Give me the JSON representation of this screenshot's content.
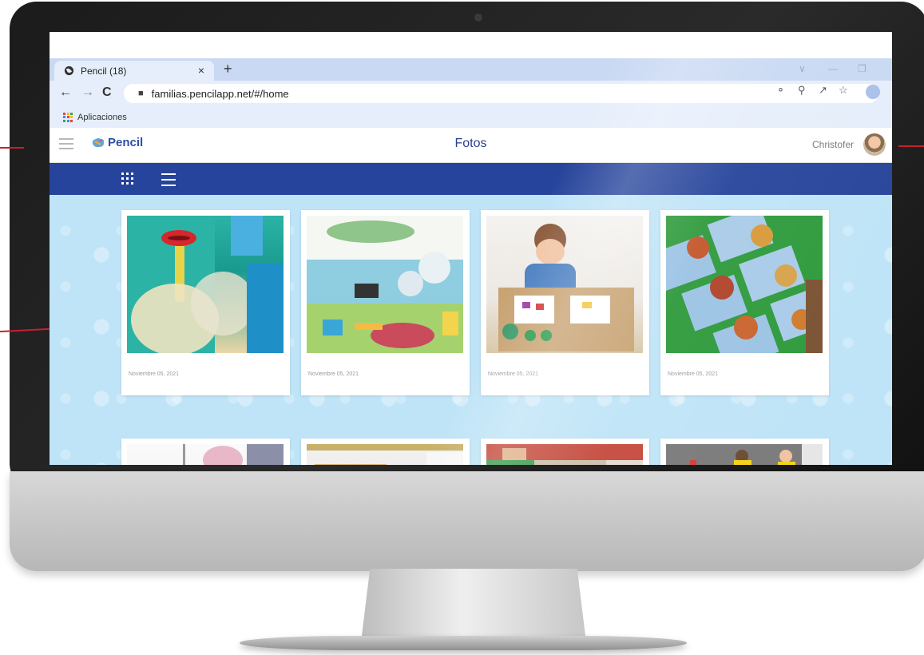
{
  "browser": {
    "tab_title": "Pencil (18)",
    "tab_close": "×",
    "new_tab": "+",
    "url": "familias.pencilapp.net/#/home",
    "bookmark_label": "Aplicaciones"
  },
  "app": {
    "logo_text": "Pencil",
    "page_title": "Fotos",
    "user_name": "Christofer"
  },
  "photos": [
    {
      "date": "Noviembre 05, 2021"
    },
    {
      "date": "Noviembre 05, 2021"
    },
    {
      "date": "Noviembre 05, 2021"
    },
    {
      "date": "Noviembre 05, 2021"
    },
    {
      "date": ""
    },
    {
      "date": ""
    },
    {
      "date": ""
    },
    {
      "date": ""
    }
  ],
  "colors": {
    "brand_blue": "#26449b",
    "content_bg": "#bfe4f7",
    "callout_red": "#c8202e"
  }
}
